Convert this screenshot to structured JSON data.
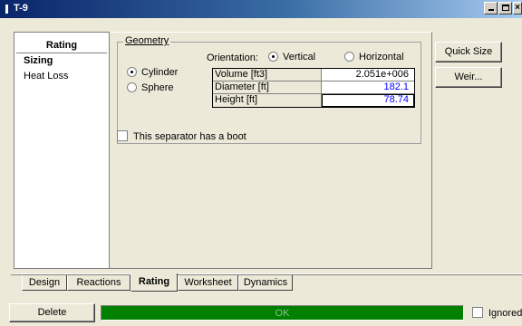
{
  "window": {
    "title": "T-9"
  },
  "sidebar": {
    "header": "Rating",
    "items": [
      {
        "label": "Sizing",
        "active": true
      },
      {
        "label": "Heat Loss",
        "active": false
      }
    ]
  },
  "geometry": {
    "legend": "Geometry",
    "orientation_label": "Orientation:",
    "orientation_options": [
      "Vertical",
      "Horizontal"
    ],
    "orientation_selected": "Vertical",
    "shape_options": [
      "Cylinder",
      "Sphere"
    ],
    "shape_selected": "Cylinder",
    "dimensions": [
      {
        "label": "Volume [ft3]",
        "value": "2.051e+006"
      },
      {
        "label": "Diameter [ft]",
        "value": "182.1"
      },
      {
        "label": "Height [ft]",
        "value": "78.74"
      }
    ]
  },
  "boot_checkbox": {
    "label": "This separator has a boot",
    "checked": false
  },
  "buttons": {
    "quick_size": "Quick Size",
    "weir": "Weir...",
    "delete": "Delete"
  },
  "tabs": [
    {
      "label": "Design",
      "active": false
    },
    {
      "label": "Reactions",
      "active": false
    },
    {
      "label": "Rating",
      "active": true
    },
    {
      "label": "Worksheet",
      "active": false
    },
    {
      "label": "Dynamics",
      "active": false
    }
  ],
  "status": {
    "text": "OK",
    "color": "#008000"
  },
  "ignored_checkbox": {
    "label": "Ignored",
    "checked": false
  }
}
